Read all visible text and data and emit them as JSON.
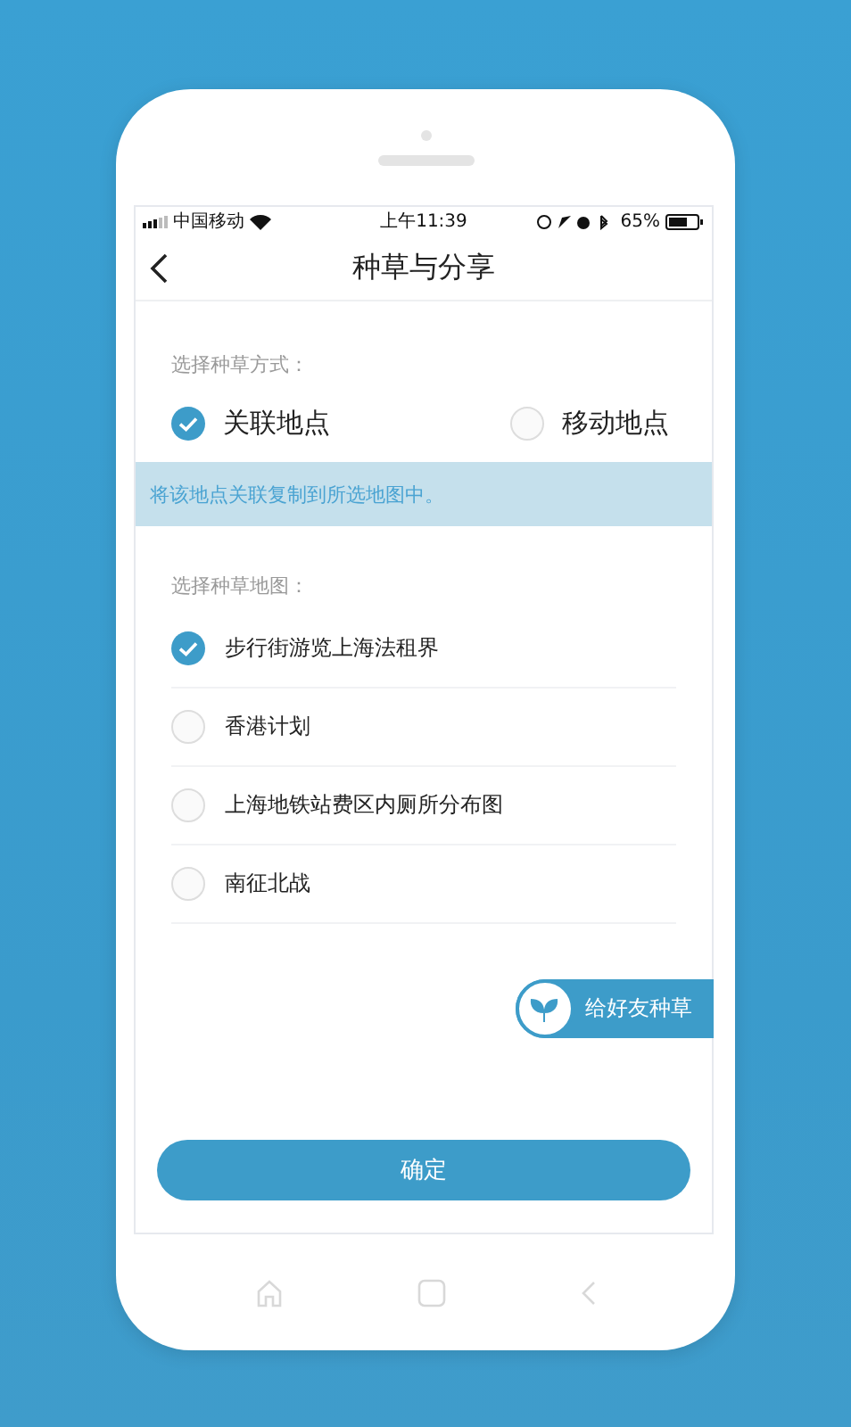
{
  "status_bar": {
    "carrier": "中国移动",
    "time": "上午11:39",
    "battery": "65%"
  },
  "nav": {
    "title": "种草与分享"
  },
  "mode": {
    "label": "选择种草方式：",
    "options": [
      {
        "label": "关联地点",
        "selected": true
      },
      {
        "label": "移动地点",
        "selected": false
      }
    ]
  },
  "hint": "将该地点关联复制到所选地图中。",
  "maps": {
    "label": "选择种草地图：",
    "items": [
      {
        "label": "步行街游览上海法租界",
        "checked": true
      },
      {
        "label": "香港计划",
        "checked": false
      },
      {
        "label": "上海地铁站费区内厕所分布图",
        "checked": false
      },
      {
        "label": "南征北战",
        "checked": false
      }
    ]
  },
  "share_button": "给好友种草",
  "confirm_button": "确定"
}
